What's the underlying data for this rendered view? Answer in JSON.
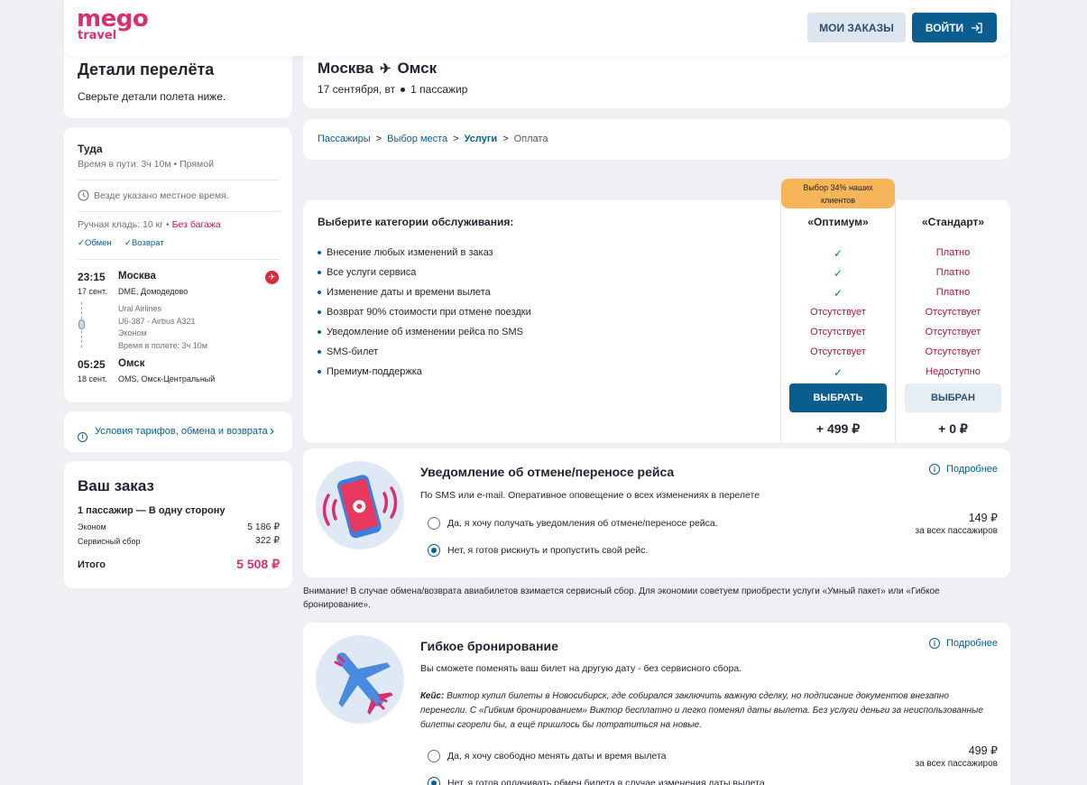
{
  "header": {
    "logo_main": "mego",
    "logo_sub": "travel",
    "orders_label": "МОИ ЗАКАЗЫ",
    "login_label": "ВОЙТИ"
  },
  "sidebar": {
    "details_title": "Детали перелёта",
    "details_subtitle": "Сверьте детали полета ниже.",
    "direction": "Туда",
    "travel_time": "Время в пути: 3ч 10м • Прямой",
    "local_time_note": "Везде указано местное время.",
    "baggage_text": "Ручная кладь: 10 кг • ",
    "baggage_none": "Без багажа",
    "exchange": "Обмен",
    "refund": "Возврат",
    "dep_time": "23:15",
    "dep_date": "17 сент.",
    "dep_city": "Москва",
    "dep_airport": "DME, Домодедово",
    "airline": "Ural Airlines",
    "flight": "U6-387 - Airbus A321",
    "cabin": "Эконом",
    "flight_time": "Время в полете: 3ч 10м",
    "arr_time": "05:25",
    "arr_date": "18 сент.",
    "arr_city": "Омск",
    "arr_airport": "OMS, Омск-Центральный",
    "tariff_link": "Условия тарифов, обмена и возврата",
    "order_title": "Ваш заказ",
    "order_summary": "1 пассажир — В одну сторону",
    "economy_label": "Эконом",
    "economy_price": "5 186 ₽",
    "service_fee_label": "Сервисный сбор",
    "service_fee_price": "322 ₽",
    "total_label": "Итого",
    "total_price": "5 508 ₽"
  },
  "route": {
    "from": "Москва",
    "to": "Омск",
    "date": "17 сентября, вт",
    "passengers": "1 пассажир"
  },
  "breadcrumb": [
    "Пассажиры",
    "Выбор места",
    "Услуги",
    "Оплата"
  ],
  "services": {
    "heading": "Выберите категории обслуживания:",
    "badge": "Выбор 34% наших клиентов",
    "plan_optimum": "«Оптимум»",
    "plan_standard": "«Стандарт»",
    "rows": [
      {
        "feature": "Внесение любых изменений в заказ",
        "optimum": "✓",
        "standard": "Платно"
      },
      {
        "feature": "Все услуги сервиса",
        "optimum": "✓",
        "standard": "Платно"
      },
      {
        "feature": "Изменение даты и времени вылета",
        "optimum": "✓",
        "standard": "Платно"
      },
      {
        "feature": "Возврат 90% стоимости при отмене поездки",
        "optimum": "Отсутствует",
        "standard": "Отсутствует"
      },
      {
        "feature": "Уведомление об изменении рейса по SMS",
        "optimum": "Отсутствует",
        "standard": "Отсутствует"
      },
      {
        "feature": "SMS-билет",
        "optimum": "Отсутствует",
        "standard": "Отсутствует"
      },
      {
        "feature": "Премиум-поддержка",
        "optimum": "✓",
        "standard": "Недоступно"
      }
    ],
    "select_label": "ВЫБРАТЬ",
    "selected_label": "ВЫБРАН",
    "optimum_price": "+ 499 ₽",
    "standard_price": "+ 0 ₽"
  },
  "notify": {
    "title": "Уведомление об отмене/переносе рейса",
    "more": "Подробнее",
    "description": "По SMS или e-mail. Оперативное оповещение о всех изменениях в перелете",
    "option_yes": "Да, я хочу получать уведомления об отмене/переносе рейса.",
    "option_no": "Нет, я готов рискнуть и пропустить свой рейс.",
    "price": "149 ₽",
    "price_note": "за всех пассажиров"
  },
  "warning": "Внимание! В случае обмена/возврата авиабилетов взимается сервисный сбор. Для экономии советуем приобрести услуги «Умный пакет» или «Гибкое бронирование».",
  "flex": {
    "title": "Гибкое бронирование",
    "more": "Подробнее",
    "description": "Вы сможете поменять ваш билет на другую дату - без сервисного сбора.",
    "case_label": "Кейс:",
    "case_text": " Виктор купил билеты в Новосибирск, где собирался заключить важную сделку, но подписание документов внезапно перенесли. С «Гибким бронированием» Виктор бесплатно и легко поменял даты вылета. Без услуги деньги за неиспользованные билеты сгорели бы, а ещё пришлось бы потратиться на новые.",
    "option_yes": "Да, я хочу свободно менять даты и время вылета",
    "option_no": "Нет, я готов оплачивать обмен билета в случае изменения даты вылета",
    "price": "499 ₽",
    "price_note": "за всех пассажиров"
  },
  "colors": {
    "brand": "#d92f6e",
    "primary": "#0a5d8f",
    "badge": "#f7b55a",
    "negative": "#a8173f"
  }
}
